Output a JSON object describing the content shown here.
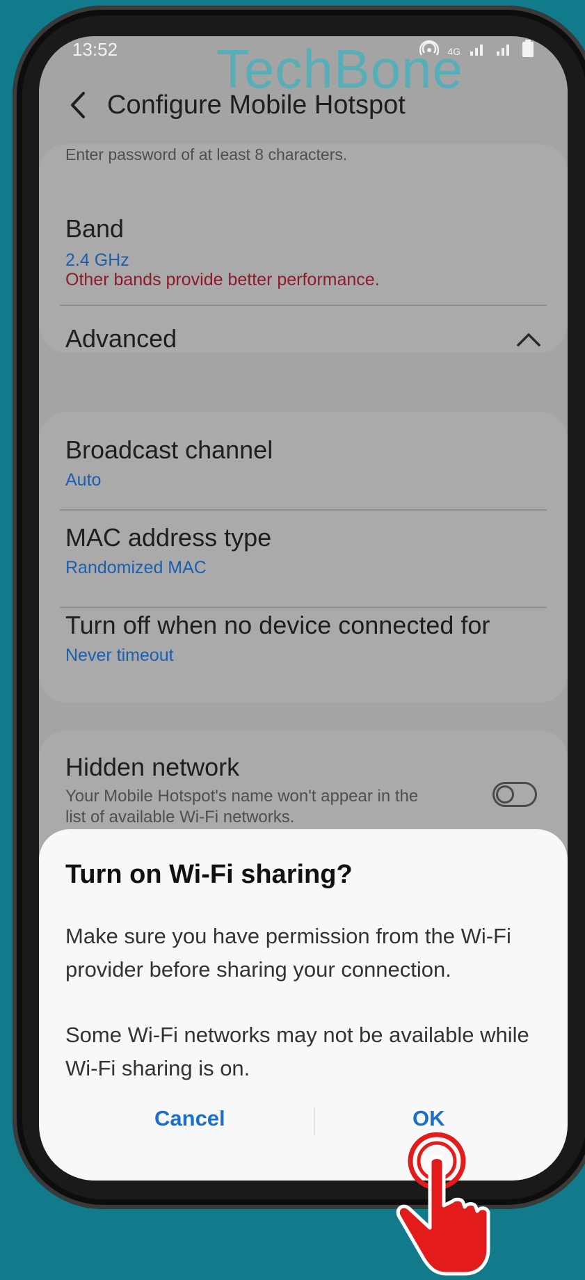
{
  "status_bar": {
    "time": "13:52",
    "network": "4G",
    "icons": [
      "hotspot-icon",
      "signal-icon",
      "signal-icon",
      "battery-icon"
    ]
  },
  "watermark": "TechBone",
  "header": {
    "title": "Configure Mobile Hotspot"
  },
  "password_hint": "Enter password of at least 8 characters.",
  "band": {
    "title": "Band",
    "value": "2.4 GHz",
    "warning": "Other bands provide better performance."
  },
  "advanced": {
    "title": "Advanced"
  },
  "settings": [
    {
      "title": "Broadcast channel",
      "value": "Auto"
    },
    {
      "title": "MAC address type",
      "value": "Randomized MAC"
    },
    {
      "title": "Turn off when no device connected for",
      "value": "Never timeout"
    }
  ],
  "hidden_network": {
    "title": "Hidden network",
    "description": "Your Mobile Hotspot's name won't appear in the list of available Wi-Fi networks.",
    "enabled": false
  },
  "dialog": {
    "title": "Turn on Wi-Fi sharing?",
    "body1": "Make sure you have permission from the Wi-Fi provider before sharing your connection.",
    "body2": "Some Wi-Fi networks may not be available while Wi-Fi sharing is on.",
    "cancel_label": "Cancel",
    "ok_label": "OK"
  },
  "colors": {
    "background": "#117b8c",
    "accent_blue": "#1a6fc8",
    "warning_red": "#8e1a2b",
    "pointer_red": "#e31b1b"
  }
}
